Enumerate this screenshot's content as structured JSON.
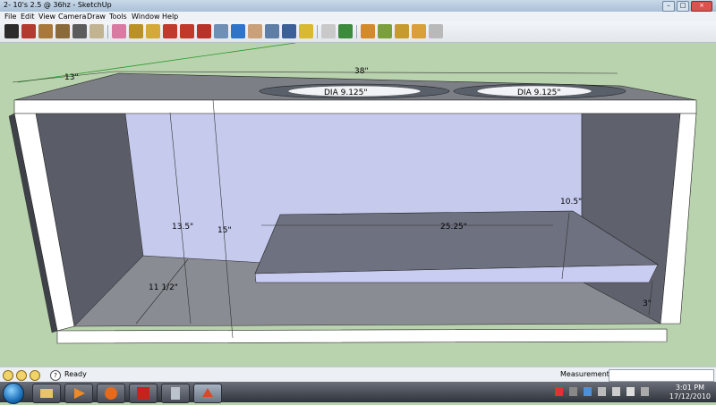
{
  "window": {
    "title": "2- 10's 2.5 @ 36hz - SketchUp",
    "minimize_glyph": "–",
    "maximize_glyph": "□",
    "close_glyph": "×"
  },
  "menu": {
    "items": [
      "File",
      "Edit",
      "View",
      "Camera",
      "Draw",
      "Tools",
      "Window",
      "Help"
    ]
  },
  "toolbar": {
    "tools": [
      {
        "name": "select-icon",
        "color": "#2b2b2b"
      },
      {
        "name": "pencil-icon",
        "color": "#b23a2e"
      },
      {
        "name": "rectangle-icon",
        "color": "#a8793b"
      },
      {
        "name": "circle-icon",
        "color": "#8a6a3a"
      },
      {
        "name": "arc-icon",
        "color": "#5c5c5c"
      },
      {
        "name": "make-component-icon",
        "color": "#c2b391"
      },
      {
        "name": "eraser-icon",
        "color": "#d97aa3"
      },
      {
        "name": "paint-bucket-icon",
        "color": "#b99126"
      },
      {
        "name": "push-pull-icon",
        "color": "#d4a93a"
      },
      {
        "name": "move-icon",
        "color": "#c03a2e"
      },
      {
        "name": "rotate-icon",
        "color": "#c0392b"
      },
      {
        "name": "follow-me-icon",
        "color": "#b8342a"
      },
      {
        "name": "offset-icon",
        "color": "#6f8fb5"
      },
      {
        "name": "orbit-icon",
        "color": "#2f74c8"
      },
      {
        "name": "pan-icon",
        "color": "#c9a07a"
      },
      {
        "name": "zoom-icon",
        "color": "#5e7ea6"
      },
      {
        "name": "zoom-extents-icon",
        "color": "#3c5f9a"
      },
      {
        "name": "previous-view-icon",
        "color": "#d9b832"
      },
      {
        "name": "next-view-icon",
        "color": "#c9c9c9"
      },
      {
        "name": "get-models-icon",
        "color": "#3c8a3c"
      },
      {
        "name": "share-model-icon",
        "color": "#d48a2b"
      },
      {
        "name": "share-component-icon",
        "color": "#7b9f3a"
      },
      {
        "name": "photo-textures-icon",
        "color": "#c79a2e"
      },
      {
        "name": "get-photo-icon",
        "color": "#d9a03a"
      },
      {
        "name": "building-maker-icon",
        "color": "#b9b9b9"
      }
    ]
  },
  "model": {
    "dims": {
      "depth": "13\"",
      "width": "38\"",
      "hole_left": "DIA 9.125\"",
      "hole_right": "DIA 9.125\"",
      "inner_height": "13.5\"",
      "outer_height": "15\"",
      "floor_depth": "11 1/2\"",
      "shelf_width": "25.25\"",
      "shelf_height": "10.5\"",
      "shelf_gap": "3\""
    }
  },
  "statusbar": {
    "ready": "Ready",
    "measurements_label": "Measurements",
    "measurements_value": "",
    "help_glyph": "?"
  },
  "taskbar": {
    "time": "3:01 PM",
    "date": "17/12/2010"
  }
}
